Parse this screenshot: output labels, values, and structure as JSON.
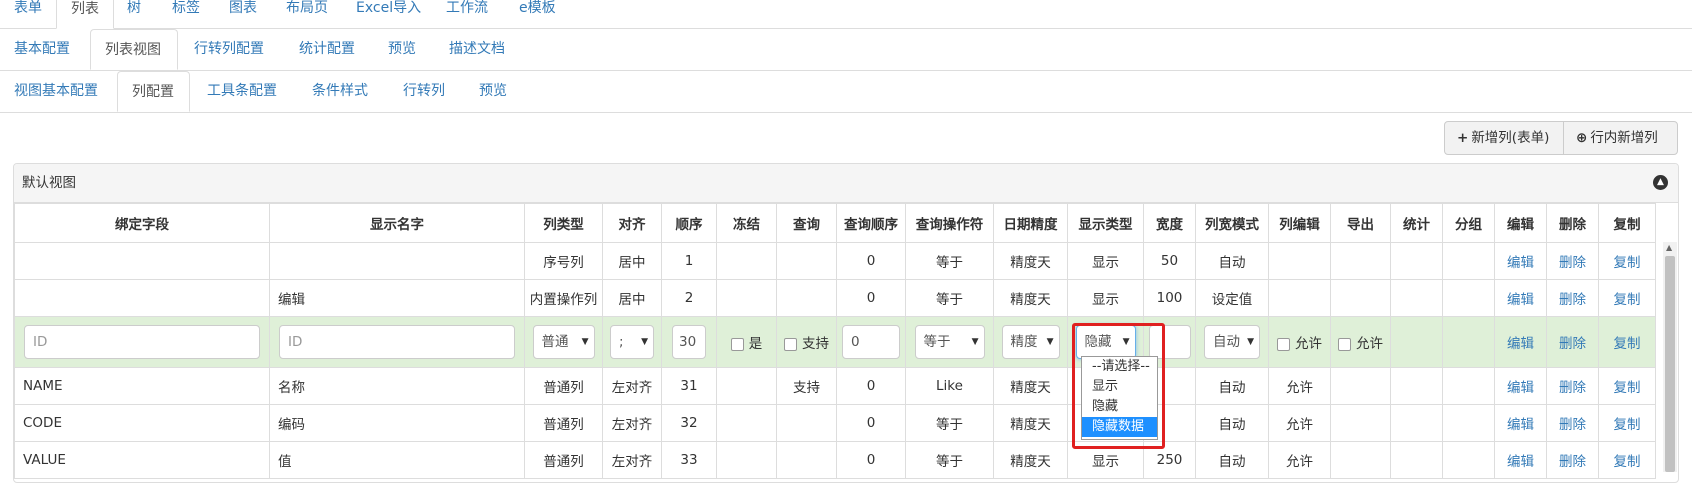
{
  "top_tabs": [
    "表单",
    "列表",
    "树",
    "标签",
    "图表",
    "布局页",
    "Excel导入",
    "工作流",
    "e模板"
  ],
  "config_tabs": [
    "基本配置",
    "列表视图",
    "行转列配置",
    "统计配置",
    "预览",
    "描述文档"
  ],
  "view_tabs": [
    "视图基本配置",
    "列配置",
    "工具条配置",
    "条件样式",
    "行转列",
    "预览"
  ],
  "buttons": {
    "add_column_form": "新增列(表单)",
    "add_column_inline": "行内新增列"
  },
  "icons": {
    "plus": "plus-icon",
    "plus_circle": "plus-circle-icon",
    "collapse": "collapse-up-icon"
  },
  "panel": {
    "title": "默认视图"
  },
  "columns": [
    "绑定字段",
    "显示名字",
    "列类型",
    "对齐",
    "顺序",
    "冻结",
    "查询",
    "查询顺序",
    "查询操作符",
    "日期精度",
    "显示类型",
    "宽度",
    "列宽模式",
    "列编辑",
    "导出",
    "统计",
    "分组",
    "编辑",
    "删除",
    "复制"
  ],
  "actions": {
    "edit": "编辑",
    "delete": "删除",
    "copy": "复制"
  },
  "rows": [
    {
      "field": "",
      "name": "",
      "type": "序号列",
      "align": "居中",
      "order": "1",
      "freeze": "",
      "query": "",
      "query_order": "0",
      "operator": "等于",
      "date_precision": "精度天",
      "display_type": "显示",
      "width": "50",
      "width_mode": "自动",
      "col_edit": "",
      "export": "",
      "stat": "",
      "group": ""
    },
    {
      "field": "",
      "name": "编辑",
      "type": "内置操作列",
      "align": "居中",
      "order": "2",
      "freeze": "",
      "query": "",
      "query_order": "0",
      "operator": "等于",
      "date_precision": "精度天",
      "display_type": "显示",
      "width": "100",
      "width_mode": "设定值",
      "col_edit": "",
      "export": "",
      "stat": "",
      "group": ""
    }
  ],
  "editing_row": {
    "field_placeholder": "ID",
    "name_placeholder": "ID",
    "type": "普通",
    "align": ";",
    "order": "30",
    "freeze_label": "是",
    "query_label": "支持",
    "query_order": "0",
    "operator": "等于",
    "date_precision": "精度",
    "display_type": "隐藏",
    "width": "",
    "width_mode": "自动",
    "col_edit_label": "允许",
    "export_label": "允许"
  },
  "rows_after": [
    {
      "field": "NAME",
      "name": "名称",
      "type": "普通列",
      "align": "左对齐",
      "order": "31",
      "freeze": "",
      "query": "支持",
      "query_order": "0",
      "operator": "Like",
      "date_precision": "精度天",
      "display_type": "",
      "width": "",
      "width_mode": "自动",
      "col_edit": "允许",
      "export": "",
      "stat": "",
      "group": ""
    },
    {
      "field": "CODE",
      "name": "编码",
      "type": "普通列",
      "align": "左对齐",
      "order": "32",
      "freeze": "",
      "query": "",
      "query_order": "0",
      "operator": "等于",
      "date_precision": "精度天",
      "display_type": "",
      "width": "",
      "width_mode": "自动",
      "col_edit": "允许",
      "export": "",
      "stat": "",
      "group": ""
    },
    {
      "field": "VALUE",
      "name": "值",
      "type": "普通列",
      "align": "左对齐",
      "order": "33",
      "freeze": "",
      "query": "",
      "query_order": "0",
      "operator": "等于",
      "date_precision": "精度天",
      "display_type": "显示",
      "width": "250",
      "width_mode": "自动",
      "col_edit": "允许",
      "export": "",
      "stat": "",
      "group": ""
    }
  ],
  "dropdown": {
    "options": [
      "--请选择--",
      "显示",
      "隐藏",
      "隐藏数据"
    ],
    "selected": "隐藏数据"
  },
  "colors": {
    "link": "#337ab7",
    "editing_row": "#dff0d8",
    "highlight": "#e02020",
    "selected_option": "#1e90ff"
  }
}
